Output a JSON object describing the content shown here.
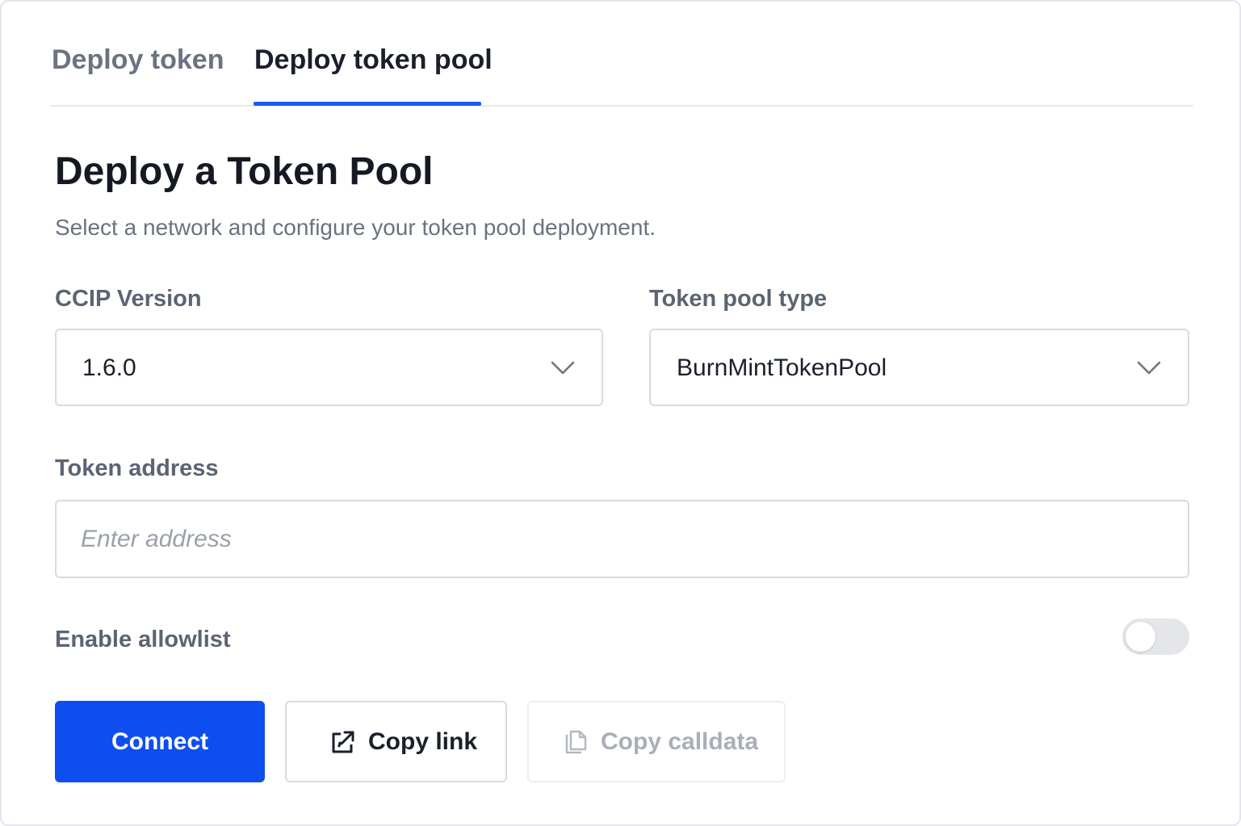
{
  "tabs": [
    {
      "label": "Deploy token",
      "active": false
    },
    {
      "label": "Deploy token pool",
      "active": true
    }
  ],
  "header": {
    "title": "Deploy a Token Pool",
    "subtitle": "Select a network and configure your token pool deployment."
  },
  "form": {
    "ccip_version": {
      "label": "CCIP Version",
      "value": "1.6.0"
    },
    "pool_type": {
      "label": "Token pool type",
      "value": "BurnMintTokenPool"
    },
    "token_address": {
      "label": "Token address",
      "value": "",
      "placeholder": "Enter address"
    },
    "allowlist": {
      "label": "Enable allowlist",
      "enabled": false
    }
  },
  "actions": {
    "connect_label": "Connect",
    "copy_link_label": "Copy link",
    "copy_calldata_label": "Copy calldata",
    "copy_calldata_disabled": true
  },
  "icons": {
    "chevron": "chevron-down-icon",
    "copy_link": "external-link-icon",
    "copy_calldata": "copy-icon"
  },
  "colors": {
    "accent": "#1a5cf0",
    "primary_button": "#0e4ef0",
    "muted_text": "#6b7280"
  }
}
